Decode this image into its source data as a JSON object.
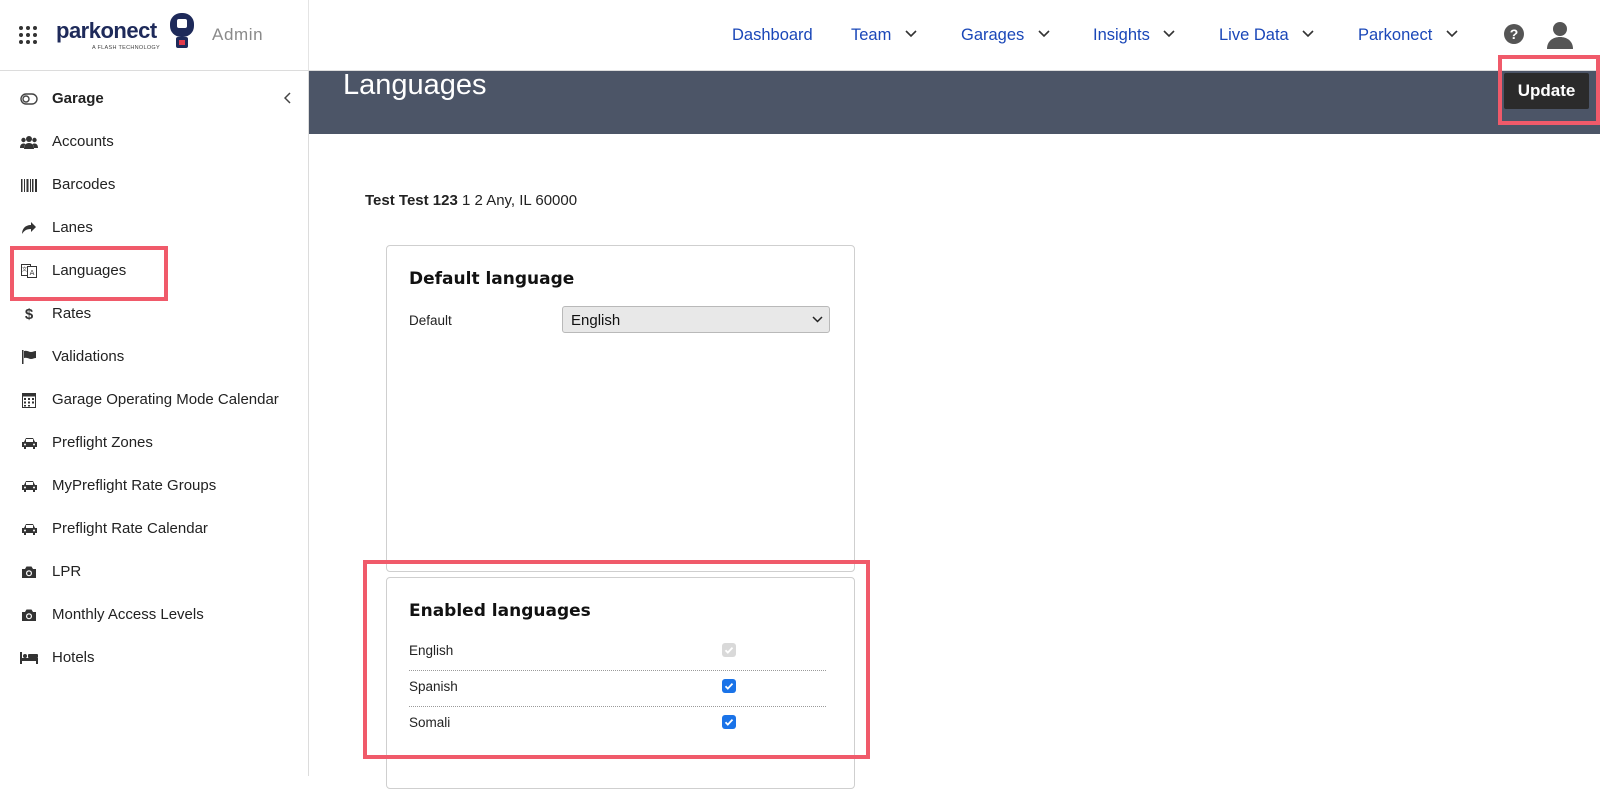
{
  "app": {
    "logo_text": "parkonect",
    "logo_sub": "A FLASH TECHNOLOGY",
    "admin_label": "Admin"
  },
  "nav": {
    "items": [
      {
        "label": "Dashboard",
        "has_menu": false
      },
      {
        "label": "Team",
        "has_menu": true
      },
      {
        "label": "Garages",
        "has_menu": true
      },
      {
        "label": "Insights",
        "has_menu": true
      },
      {
        "label": "Live Data",
        "has_menu": true
      },
      {
        "label": "Parkonect",
        "has_menu": true
      }
    ],
    "icons": [
      "apps-grid-icon",
      "help-icon",
      "user-account-icon"
    ]
  },
  "sidebar": {
    "header": {
      "label": "Garage",
      "icon": "toggle-icon"
    },
    "items": [
      {
        "label": "Accounts",
        "icon": "users-icon"
      },
      {
        "label": "Barcodes",
        "icon": "barcode-icon"
      },
      {
        "label": "Lanes",
        "icon": "share-arrow-icon"
      },
      {
        "label": "Languages",
        "icon": "language-icon"
      },
      {
        "label": "Rates",
        "icon": "dollar-icon"
      },
      {
        "label": "Validations",
        "icon": "flag-icon"
      },
      {
        "label": "Garage Operating Mode Calendar",
        "icon": "calendar-icon"
      },
      {
        "label": "Preflight Zones",
        "icon": "car-icon"
      },
      {
        "label": "MyPreflight Rate Groups",
        "icon": "car-icon"
      },
      {
        "label": "Preflight Rate Calendar",
        "icon": "car-icon"
      },
      {
        "label": "LPR",
        "icon": "camera-icon"
      },
      {
        "label": "Monthly Access Levels",
        "icon": "camera-icon"
      },
      {
        "label": "Hotels",
        "icon": "bed-icon"
      }
    ]
  },
  "page": {
    "title": "Languages",
    "update_label": "Update",
    "garage_name": "Test Test 123",
    "garage_address": " 1 2 Any,  IL  60000"
  },
  "default_card": {
    "title": "Default language",
    "field_label": "Default",
    "selected": "English"
  },
  "enabled_card": {
    "title": "Enabled languages",
    "languages": [
      {
        "name": "English",
        "checked": true,
        "disabled": true
      },
      {
        "name": "Spanish",
        "checked": true,
        "disabled": false
      },
      {
        "name": "Somali",
        "checked": true,
        "disabled": false
      }
    ]
  },
  "colors": {
    "header_band": "#4c5567",
    "nav_link": "#1a47b8",
    "highlight": "#f05a6a",
    "checkbox": "#1a73e8"
  }
}
